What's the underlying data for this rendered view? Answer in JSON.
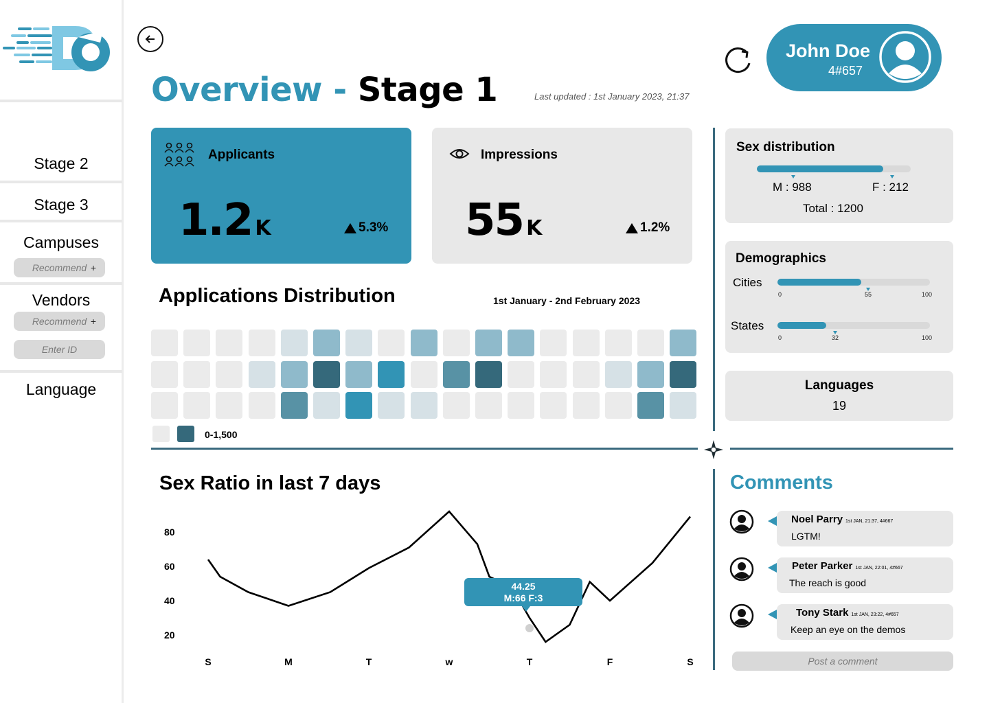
{
  "sidebar": {
    "logo": "do-logo",
    "items": [
      {
        "label": "Stage 2"
      },
      {
        "label": "Stage 3"
      },
      {
        "label": "Campuses"
      },
      {
        "label": "Vendors"
      },
      {
        "label": "Language"
      }
    ],
    "campuses_recommend": "Recommend",
    "vendors_recommend": "Recommend",
    "enter_id_placeholder": "Enter ID",
    "plus": "+"
  },
  "header": {
    "title_primary": "Overview",
    "title_separator": "-",
    "title_secondary": "Stage 1",
    "last_updated": "Last updated : 1st January 2023, 21:37",
    "user_name": "John Doe",
    "user_id": "4#657"
  },
  "stats": {
    "applicants": {
      "label": "Applicants",
      "value": "1.2",
      "unit": "K",
      "delta": "5.3%",
      "icon": "people-group-icon"
    },
    "impressions": {
      "label": "Impressions",
      "value": "55",
      "unit": "K",
      "delta": "1.2%",
      "icon": "eye-icon"
    }
  },
  "distribution": {
    "title": "Applications Distribution",
    "date_range": "1st January - 2nd February 2023",
    "legend_label": "0-1,500",
    "levels": [
      [
        0,
        0,
        0,
        0,
        1,
        3,
        1,
        0,
        3,
        0,
        3,
        3,
        0,
        0,
        0,
        0,
        3
      ],
      [
        0,
        0,
        0,
        1,
        3,
        6,
        3,
        5,
        0,
        4,
        6,
        0,
        0,
        0,
        1,
        3,
        6
      ],
      [
        0,
        0,
        0,
        0,
        4,
        1,
        5,
        1,
        1,
        0,
        0,
        0,
        0,
        0,
        0,
        4,
        1
      ]
    ],
    "palette": [
      "#ebebeb",
      "#d6e1e6",
      "#c7dbe3",
      "#8fbacb",
      "#5892a5",
      "#3294b5",
      "#35697b"
    ]
  },
  "sex_ratio": {
    "title": "Sex Ratio in last 7 days",
    "tooltip_value": "44.25",
    "tooltip_detail": "M:66   F:3"
  },
  "chart_data": {
    "type": "line",
    "title": "Sex Ratio in last 7 days",
    "categories": [
      "S",
      "M",
      "T",
      "w",
      "T",
      "F",
      "S"
    ],
    "x": [
      0,
      0.15,
      0.5,
      1,
      1.52,
      2,
      2.5,
      3,
      3.35,
      3.5,
      3.78,
      4,
      4.2,
      4.5,
      4.75,
      5,
      5.53,
      6
    ],
    "y": [
      64,
      54,
      45,
      37,
      45,
      59,
      71,
      92,
      73,
      54,
      48,
      30,
      16,
      26,
      51,
      40,
      62,
      89
    ],
    "yticks": [
      20,
      40,
      60,
      80
    ],
    "ylim": [
      10,
      95
    ],
    "highlight": {
      "x": 4,
      "y": 24
    }
  },
  "sex_distribution": {
    "title": "Sex distribution",
    "male_label": "M : 988",
    "female_label": "F : 212",
    "total_label": "Total : 1200",
    "male_fraction": 0.8233
  },
  "demographics": {
    "title": "Demographics",
    "cities": {
      "label": "Cities",
      "value": 55,
      "value_label": "55",
      "min_label": "0",
      "max_label": "100"
    },
    "states": {
      "label": "States",
      "value": 32,
      "value_label": "32",
      "min_label": "0",
      "max_label": "100"
    }
  },
  "languages": {
    "title": "Languages",
    "value": "19"
  },
  "comments": {
    "title": "Comments",
    "items": [
      {
        "author": "Noel Parry",
        "meta": "1st JAN, 21:37, 4#667",
        "text": "LGTM!"
      },
      {
        "author": "Peter Parker",
        "meta": "1st JAN, 22:01, 4#667",
        "text": "The reach is good"
      },
      {
        "author": "Tony Stark",
        "meta": "1st JAN, 23:22, 4#657",
        "text": "Keep an eye on the demos"
      }
    ],
    "post_placeholder": "Post a comment"
  },
  "colors": {
    "accent": "#3294b5",
    "panel": "#e8e8e8",
    "divider": "#3a6a7e"
  }
}
